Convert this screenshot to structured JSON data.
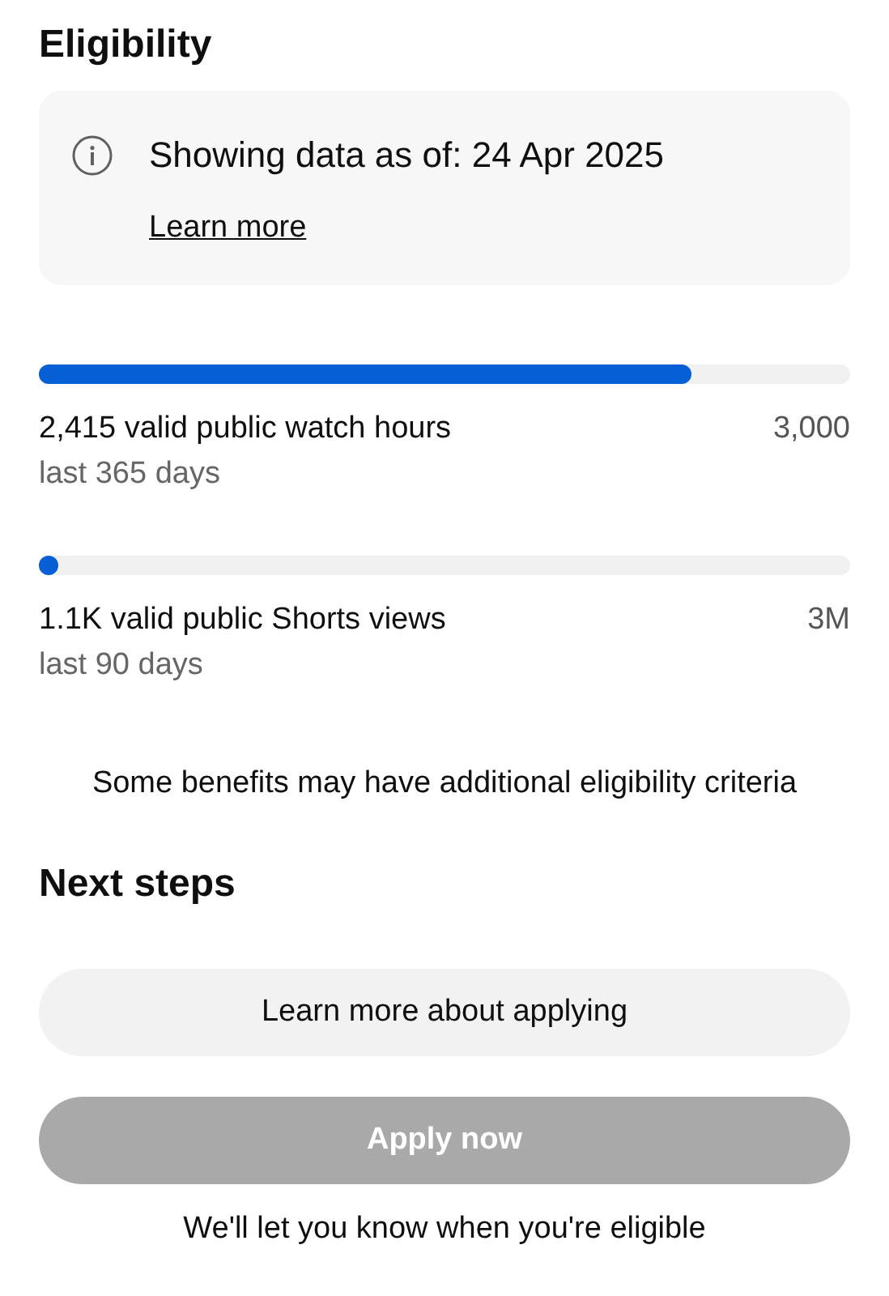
{
  "title": "Eligibility",
  "info": {
    "text": "Showing data as of: 24 Apr 2025",
    "link": "Learn more"
  },
  "metrics": [
    {
      "label": "2,415 valid public watch hours",
      "target": "3,000",
      "period": "last 365 days",
      "level": 0.805
    },
    {
      "label": "1.1K valid public Shorts views",
      "target": "3M",
      "period": "last 90 days",
      "level": 0.0004
    }
  ],
  "note": "Some benefits may have additional eligibility criteria",
  "next_steps": {
    "title": "Next steps",
    "buttons": [
      {
        "label": "Learn more about applying",
        "disabled": false
      },
      {
        "label": "Apply now",
        "disabled": true
      }
    ],
    "footer": "We'll let you know when you're eligible"
  }
}
